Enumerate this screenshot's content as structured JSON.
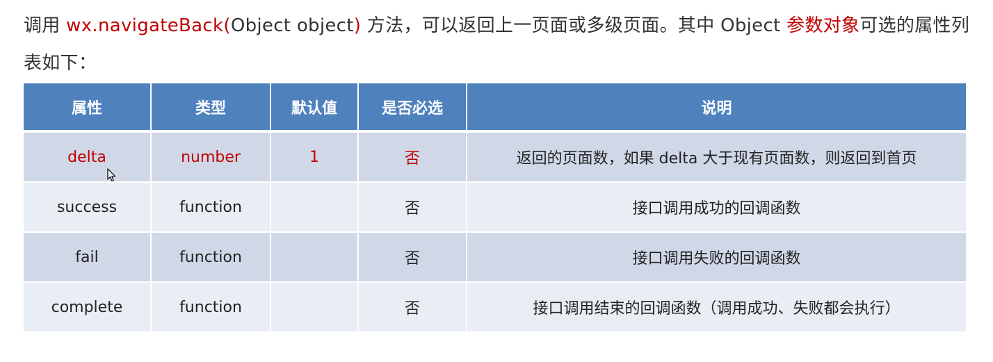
{
  "intro": {
    "seg1": "调用 ",
    "api": "wx.navigateBack(",
    "seg2": "Object object",
    "api_close": ")",
    "seg3": " 方法，可以返回上一页面或多级页面。其中 Object ",
    "param": "参数对象",
    "seg4": "可选的属性列表如下："
  },
  "table": {
    "headers": [
      "属性",
      "类型",
      "默认值",
      "是否必选",
      "说明"
    ],
    "rows": [
      [
        "delta",
        "number",
        "1",
        "否",
        "返回的页面数，如果 delta 大于现有页面数，则返回到首页"
      ],
      [
        "success",
        "function",
        "",
        "否",
        "接口调用成功的回调函数"
      ],
      [
        "fail",
        "function",
        "",
        "否",
        "接口调用失败的回调函数"
      ],
      [
        "complete",
        "function",
        "",
        "否",
        "接口调用结束的回调函数（调用成功、失败都会执行）"
      ]
    ]
  },
  "colors": {
    "header_bg": "#4f81bd",
    "row_odd": "#d0d8e8",
    "row_even": "#e9edf4",
    "highlight_red": "#c00000"
  }
}
